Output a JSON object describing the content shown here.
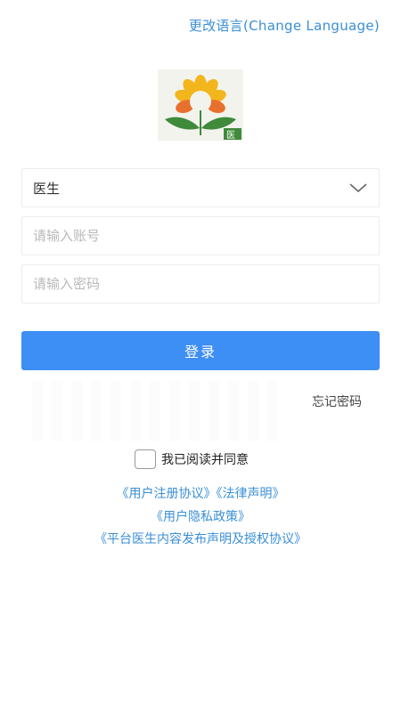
{
  "header": {
    "language_link": "更改语言(Change Language)"
  },
  "logo": {
    "badge_text": "医",
    "colors": {
      "petal": "#f3b51c",
      "petal_orange": "#e8702e",
      "leaf": "#3f8a3b"
    }
  },
  "form": {
    "role_select": {
      "selected": "医生",
      "icon": "chevron-down-icon"
    },
    "account": {
      "placeholder": "请输入账号"
    },
    "password": {
      "placeholder": "请输入密码"
    },
    "login_label": "登录",
    "forgot_label": "忘记密码"
  },
  "agreement": {
    "label": "我已阅读并同意",
    "links": {
      "user_registration": "《用户注册协议》",
      "legal_statement": "《法律声明》",
      "privacy_policy": "《用户隐私政策》",
      "content_authorization": "《平台医生内容发布声明及授权协议》"
    }
  },
  "colors": {
    "accent": "#3d8ef5",
    "link": "#3a8fd6"
  }
}
